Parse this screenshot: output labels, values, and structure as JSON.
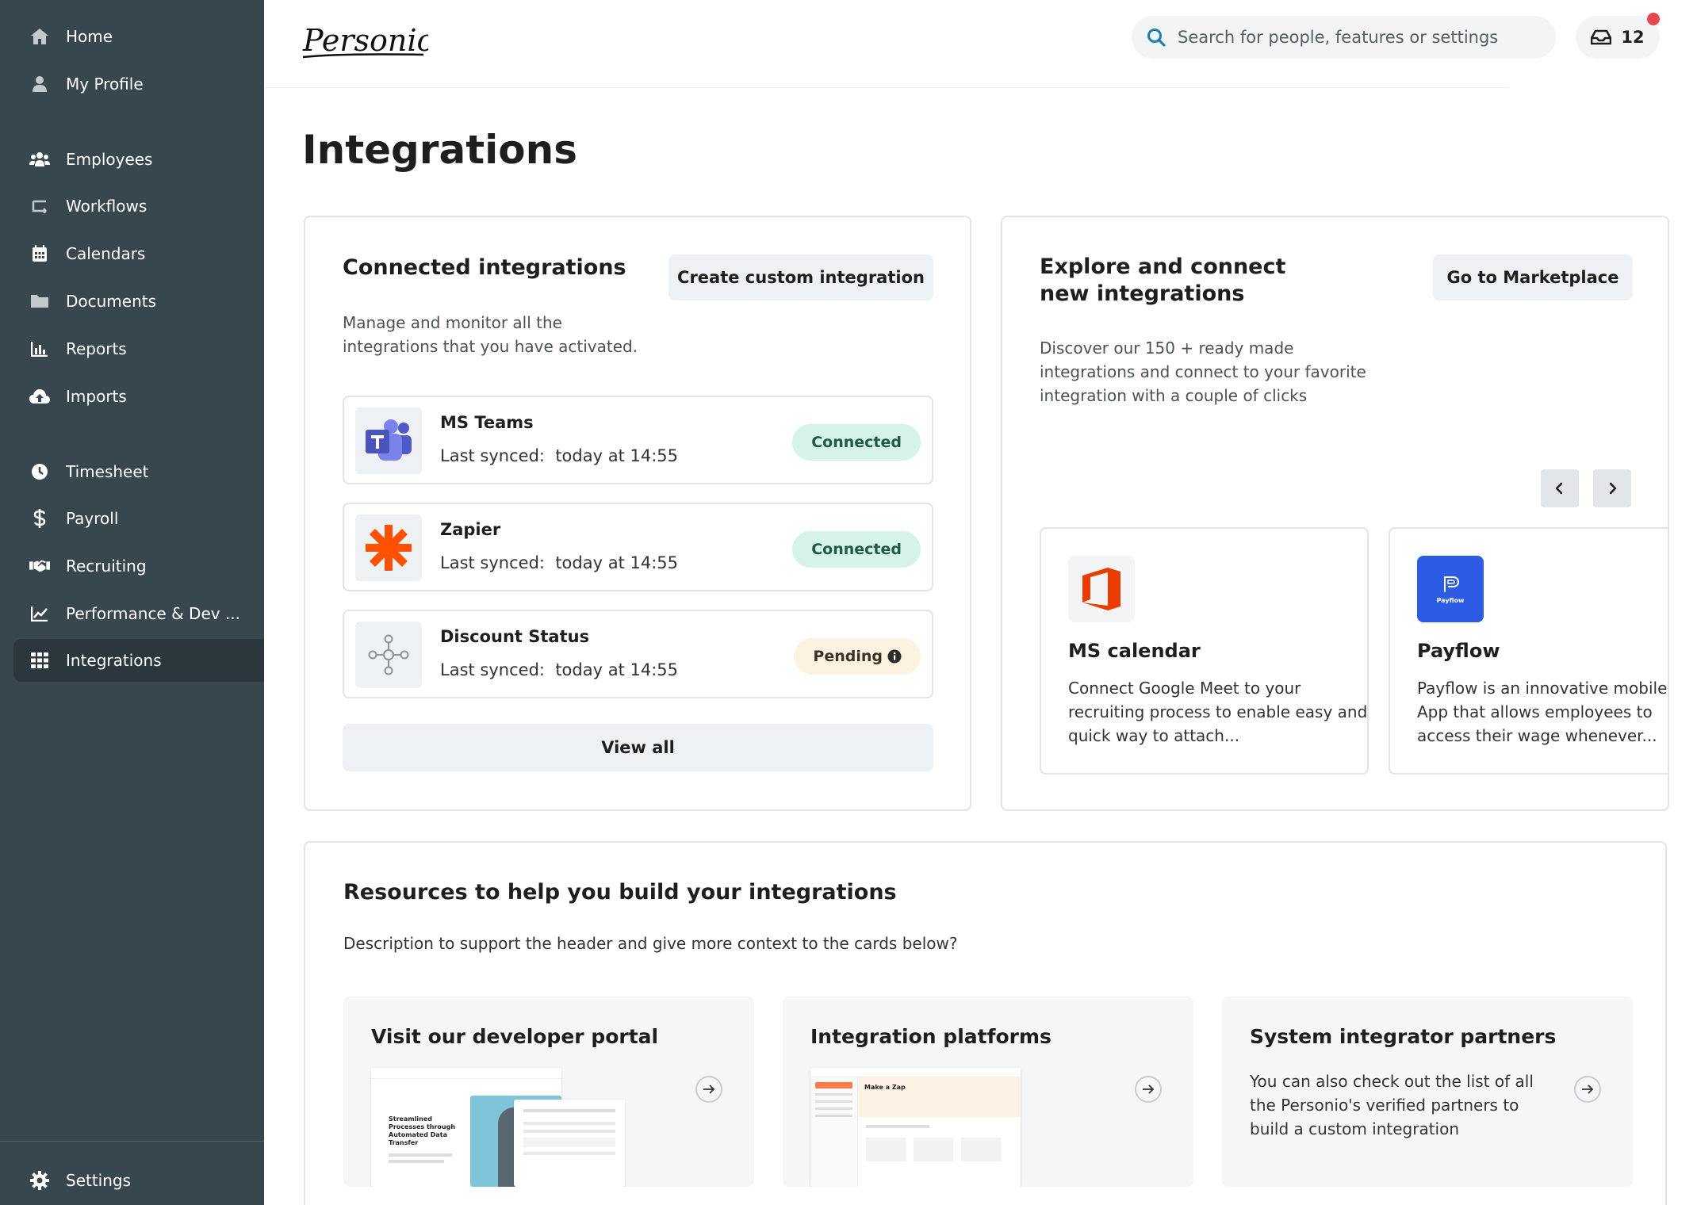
{
  "sidebar": {
    "items": [
      {
        "label": "Home",
        "icon": "home-icon"
      },
      {
        "label": "My Profile",
        "icon": "user-icon"
      },
      {
        "label": "Employees",
        "icon": "users-icon"
      },
      {
        "label": "Workflows",
        "icon": "workflow-icon"
      },
      {
        "label": "Calendars",
        "icon": "calendar-icon"
      },
      {
        "label": "Documents",
        "icon": "folder-icon"
      },
      {
        "label": "Reports",
        "icon": "chart-bar-icon"
      },
      {
        "label": "Imports",
        "icon": "cloud-upload-icon"
      },
      {
        "label": "Timesheet",
        "icon": "clock-icon"
      },
      {
        "label": "Payroll",
        "icon": "dollar-icon"
      },
      {
        "label": "Recruiting",
        "icon": "handshake-icon"
      },
      {
        "label": "Performance & Dev ...",
        "icon": "line-chart-icon"
      },
      {
        "label": "Integrations",
        "icon": "grid-icon"
      }
    ],
    "active": "Integrations",
    "settings_label": "Settings"
  },
  "header": {
    "logo_text": "Personio",
    "search_placeholder": "Search for people, features or settings",
    "inbox_count": "12"
  },
  "page_title": "Integrations",
  "connected": {
    "title": "Connected integrations",
    "create_button": "Create custom integration",
    "description": "Manage and monitor all the integrations that you have activated.",
    "items": [
      {
        "name": "MS Teams",
        "sync_label": "Last synced:",
        "sync_time": "today at 14:55",
        "status": "Connected"
      },
      {
        "name": "Zapier",
        "sync_label": "Last synced:",
        "sync_time": "today at 14:55",
        "status": "Connected"
      },
      {
        "name": "Discount Status",
        "sync_label": "Last synced:",
        "sync_time": "today at 14:55",
        "status": "Pending"
      }
    ],
    "view_all": "View all"
  },
  "explore": {
    "title": "Explore and connect new integrations",
    "marketplace_button": "Go to Marketplace",
    "description": "Discover our 150 + ready made integrations and connect to your favorite integration with a couple of clicks",
    "cards": [
      {
        "name": "MS calendar",
        "description": "Connect Google Meet to your recruiting process to enable easy and quick way to attach..."
      },
      {
        "name": "Payflow",
        "description": "Payflow is an innovative mobile App that allows employees to access their wage whenever...",
        "logo_text": "Payflow"
      }
    ]
  },
  "resources": {
    "title": "Resources to help you build your integrations",
    "description": "Description to support the header and give more context to the cards below?",
    "cards": [
      {
        "title": "Visit our developer portal",
        "thumb_text": "Streamlined Processes through Automated Data Transfer"
      },
      {
        "title": "Integration platforms",
        "thumb_text": "Make a Zap"
      },
      {
        "title": "System integrator partners",
        "description": "You can also check out the list of all the Personio's verified partners to build a custom integration"
      }
    ]
  },
  "colors": {
    "sidebar_bg": "#38464d",
    "connected_badge": "#d5f3e6",
    "pending_badge": "#fdf1e2",
    "zapier": "#ff4f00",
    "office": "#eb3c00",
    "payflow": "#2d5be3",
    "teams": "#5059c9"
  }
}
